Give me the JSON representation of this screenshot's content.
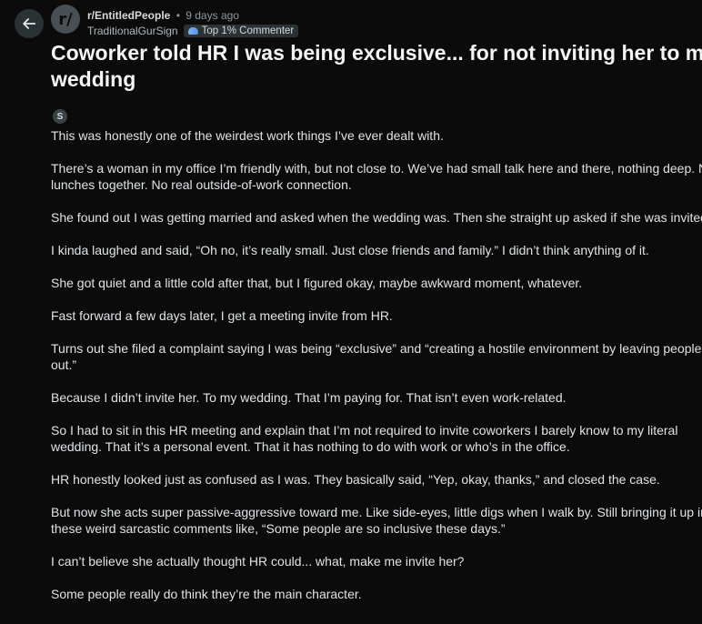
{
  "header": {
    "subreddit": "r/EntitledPeople",
    "separator": "•",
    "age": "9 days ago",
    "avatar_glyph": "r/",
    "username": "TraditionalGurSign",
    "flair": "Top 1% Commenter"
  },
  "post": {
    "title_line1": "Coworker told HR I was being exclusive... for not inviting her to my",
    "title_line2": "wedding",
    "badge": "S",
    "paragraphs": [
      [
        "This was honestly one of the weirdest work things I’ve ever dealt with."
      ],
      [
        "There’s a woman in my office I’m friendly with, but not close to. We’ve had small talk here and there, nothing deep. No",
        "lunches together. No real outside-of-work connection."
      ],
      [
        "She found out I was getting married and asked when the wedding was. Then she straight up asked if she was invited."
      ],
      [
        "I kinda laughed and said, “Oh no, it’s really small. Just close friends and family.” I didn’t think anything of it."
      ],
      [
        "She got quiet and a little cold after that, but I figured okay, maybe awkward moment, whatever."
      ],
      [
        "Fast forward a few days later, I get a meeting invite from HR."
      ],
      [
        "Turns out she filed a complaint saying I was being “exclusive” and “creating a hostile environment by leaving people",
        "out.”"
      ],
      [
        "Because I didn’t invite her. To my wedding. That I’m paying for. That isn’t even work-related."
      ],
      [
        "So I had to sit in this HR meeting and explain that I’m not required to invite coworkers I barely know to my literal",
        "wedding. That it’s a personal event. That it has nothing to do with work or who’s in the office."
      ],
      [
        "HR honestly looked just as confused as I was. They basically said, “Yep, okay, thanks,” and closed the case."
      ],
      [
        "But now she acts super passive-aggressive toward me. Like side-eyes, little digs when I walk by. Still bringing it up in",
        "these weird sarcastic comments like, “Some people are so inclusive these days.”"
      ],
      [
        "I can’t believe she actually thought HR could... what, make me invite her?"
      ],
      [
        "Some people really do think they’re the main character."
      ]
    ]
  },
  "colors": {
    "background": "#0b0b0c",
    "text": "#dfe3e5",
    "muted": "#8c979d"
  }
}
